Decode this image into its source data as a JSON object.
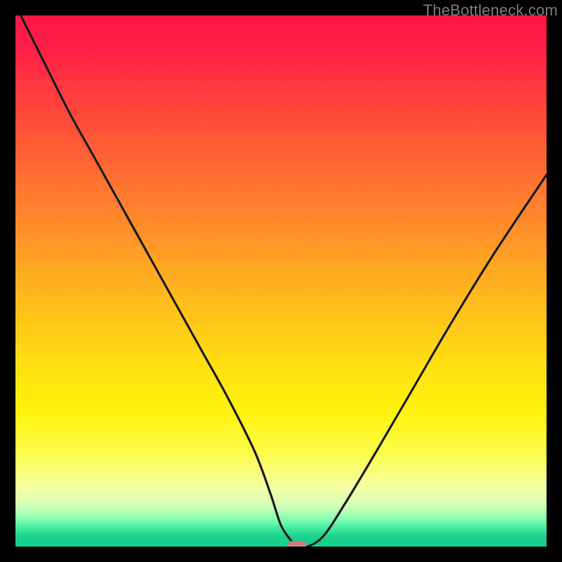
{
  "watermark": {
    "text": "TheBottleneck.com"
  },
  "colors": {
    "frame": "#000000",
    "watermark": "#7a7a7a",
    "curve": "#1d1d1d",
    "marker": "#d77a7d",
    "gradient_stops": [
      "#ff1744",
      "#ff1e47",
      "#ff3a3f",
      "#ff5a36",
      "#ff7d2e",
      "#ffa224",
      "#ffc21a",
      "#ffe012",
      "#fff20a",
      "#fcfc45",
      "#f5ffa6",
      "#cfffb8",
      "#7dffb0",
      "#34e39a",
      "#1fd18e",
      "#17cf8a",
      "#10d588"
    ]
  },
  "chart_data": {
    "type": "line",
    "title": "",
    "xlabel": "",
    "ylabel": "",
    "xlim": [
      0,
      100
    ],
    "ylim": [
      0,
      100
    ],
    "grid": false,
    "legend": false,
    "annotations": [
      "TheBottleneck.com"
    ],
    "optimum_x": 53,
    "marker": {
      "x": 53,
      "y": 0,
      "shape": "rounded-rect"
    },
    "background": {
      "direction": "vertical",
      "meaning_top": "high-bottleneck",
      "meaning_bottom": "no-bottleneck"
    },
    "series": [
      {
        "name": "bottleneck-curve",
        "x": [
          1,
          5,
          10,
          15,
          20,
          25,
          30,
          35,
          40,
          45,
          48,
          50,
          52,
          53,
          55,
          58,
          62,
          68,
          75,
          82,
          90,
          100
        ],
        "y": [
          100,
          92,
          82,
          73,
          64,
          55,
          46,
          37,
          28,
          18,
          10,
          4,
          1,
          0,
          0,
          2,
          8,
          18,
          30,
          42,
          55,
          70
        ]
      }
    ]
  }
}
